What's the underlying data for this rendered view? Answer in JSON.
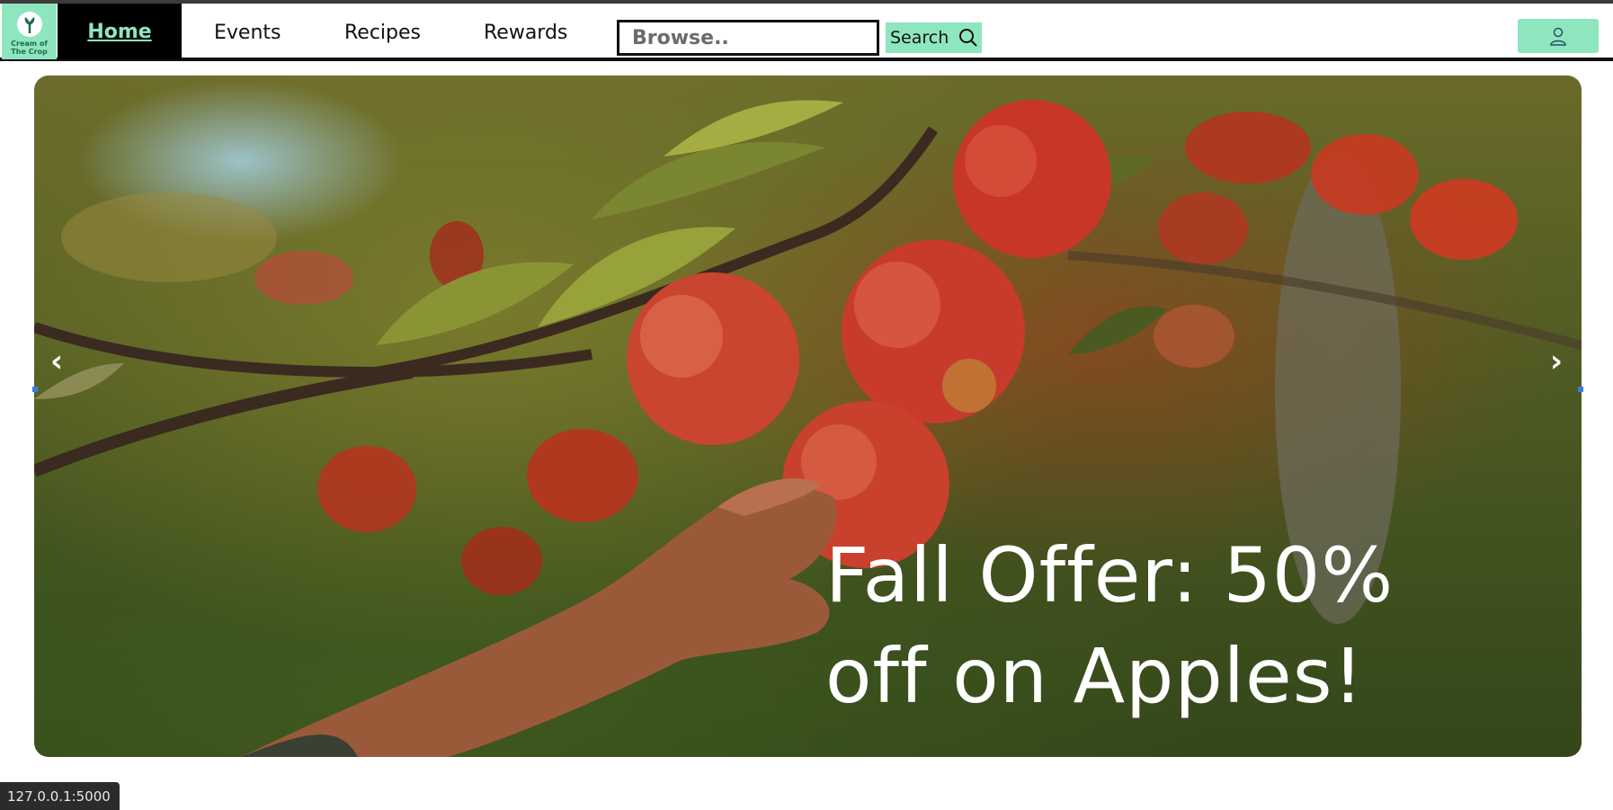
{
  "navbar": {
    "logo_text": "Cream of\nThe Crop",
    "links": {
      "home": "Home",
      "events": "Events",
      "recipes": "Recipes",
      "rewards": "Rewards"
    },
    "search": {
      "placeholder": "Browse..",
      "button_label": "Search"
    },
    "user_icon": "user-icon"
  },
  "hero": {
    "caption_line1": "Fall Offer: 50%",
    "caption_line2": "off on Apples!",
    "prev_arrow": "‹",
    "next_arrow": "›"
  },
  "status_bar": {
    "url": "127.0.0.1:5000"
  },
  "colors": {
    "accent": "#8ee6bf",
    "home_bg": "#000000",
    "text": "#111111"
  }
}
